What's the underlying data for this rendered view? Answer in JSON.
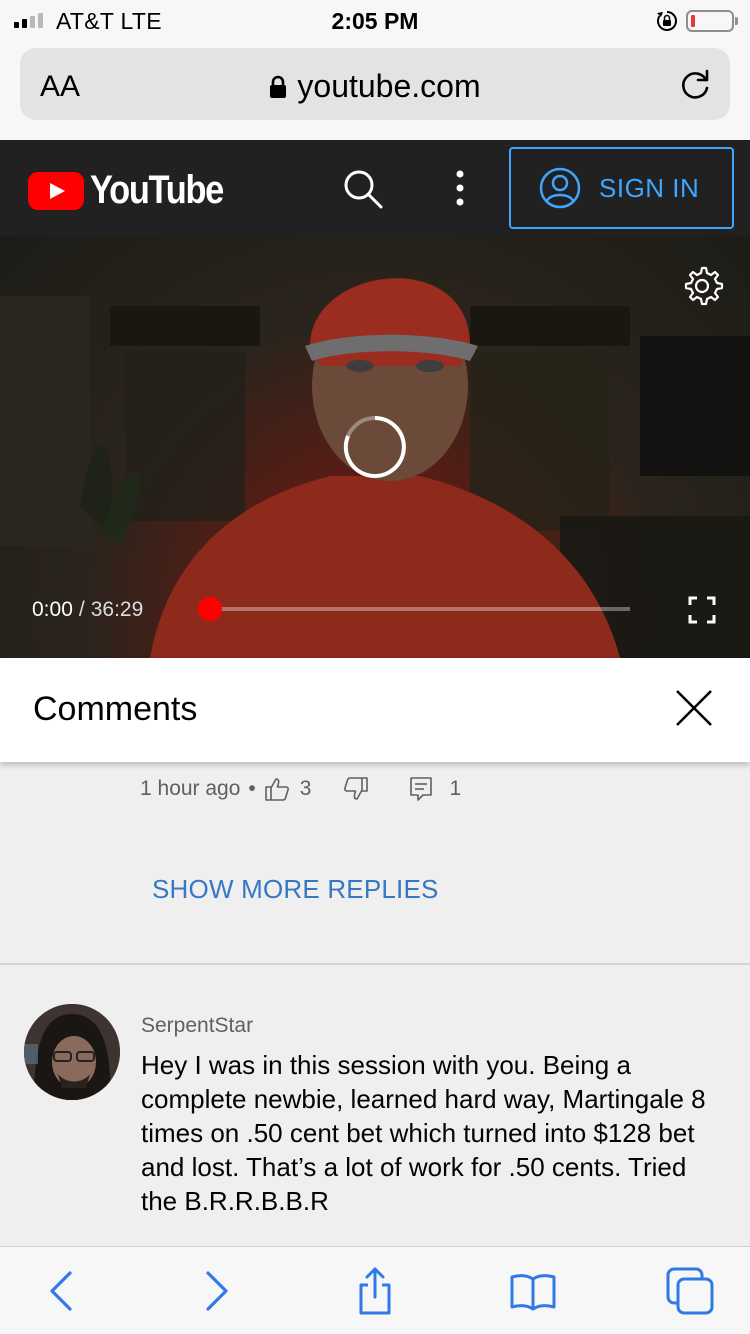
{
  "status_bar": {
    "carrier": "AT&T  LTE",
    "time": "2:05 PM"
  },
  "browser": {
    "text_size_label": "AA",
    "url": "youtube.com"
  },
  "youtube": {
    "logo_text": "YouTube",
    "sign_in_label": "SIGN IN",
    "accent_color": "#3ea6ff",
    "brand_color": "#ff0000"
  },
  "player": {
    "current_time": "0:00",
    "separator": "/",
    "duration": "36:29",
    "progress_fraction": 0
  },
  "comments_panel": {
    "title": "Comments",
    "previous_reply": {
      "timestamp": "1 hour ago",
      "separator": "•",
      "likes": "3",
      "replies": "1"
    },
    "show_more_label": "SHOW MORE REPLIES",
    "comment": {
      "author": "SerpentStar",
      "text": "Hey I was in this session with you. Being a complete newbie, learned hard way, Martingale 8 times on .50 cent bet which turned into $128 bet and lost. That’s a lot of work for .50 cents. Tried the B.R.R.B.B.R"
    }
  },
  "icons": {
    "status": [
      "signal-icon",
      "rotation-lock-icon",
      "battery-icon"
    ],
    "browser": [
      "padlock-icon",
      "reload-icon"
    ],
    "youtube": [
      "youtube-play-icon",
      "search-icon",
      "more-vert-icon",
      "account-icon",
      "gear-icon",
      "loading-spinner-icon",
      "fullscreen-icon",
      "close-icon",
      "thumbs-up-icon",
      "thumbs-down-icon",
      "reply-icon"
    ],
    "toolbar": [
      "back-arrow-icon",
      "forward-arrow-icon",
      "share-icon",
      "bookmarks-icon",
      "tabs-icon"
    ]
  }
}
